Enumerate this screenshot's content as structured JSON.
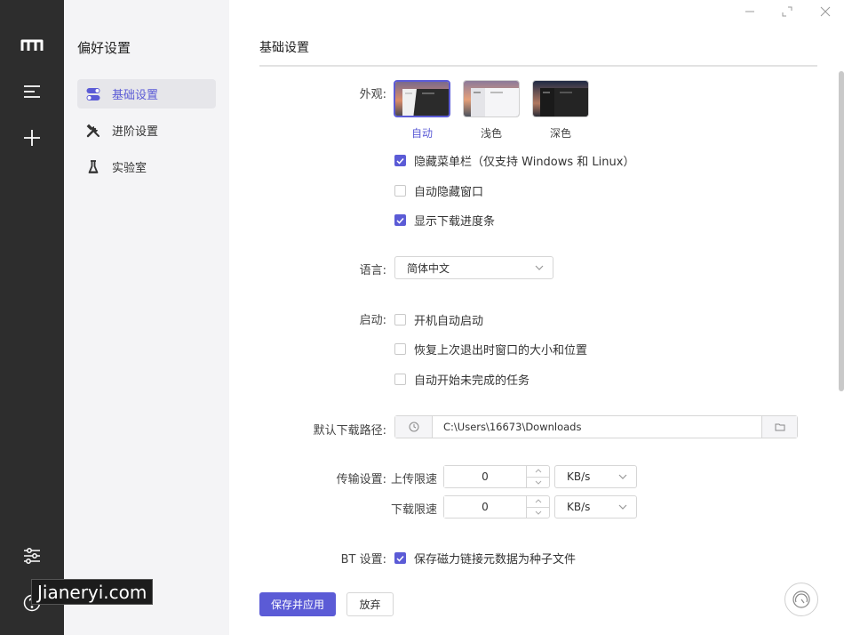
{
  "nav": {
    "title": "偏好设置",
    "items": [
      {
        "label": "基础设置",
        "icon": "toggle-icon"
      },
      {
        "label": "进阶设置",
        "icon": "tools-icon"
      },
      {
        "label": "实验室",
        "icon": "flask-icon"
      }
    ]
  },
  "main": {
    "title": "基础设置",
    "appearance": {
      "label": "外观:",
      "themes": [
        {
          "name": "自动",
          "selected": true
        },
        {
          "name": "浅色",
          "selected": false
        },
        {
          "name": "深色",
          "selected": false
        }
      ],
      "options": [
        {
          "label": "隐藏菜单栏（仅支持 Windows 和 Linux）",
          "checked": true
        },
        {
          "label": "自动隐藏窗口",
          "checked": false
        },
        {
          "label": "显示下载进度条",
          "checked": true
        }
      ]
    },
    "language": {
      "label": "语言:",
      "value": "简体中文"
    },
    "startup": {
      "label": "启动:",
      "options": [
        {
          "label": "开机自动启动",
          "checked": false
        },
        {
          "label": "恢复上次退出时窗口的大小和位置",
          "checked": false
        },
        {
          "label": "自动开始未完成的任务",
          "checked": false
        }
      ]
    },
    "download_path": {
      "label": "默认下载路径:",
      "value": "C:\\Users\\16673\\Downloads"
    },
    "transfer": {
      "label": "传输设置:",
      "upload": {
        "label": "上传限速",
        "value": "0",
        "unit": "KB/s"
      },
      "download": {
        "label": "下载限速",
        "value": "0",
        "unit": "KB/s"
      }
    },
    "bt": {
      "label": "BT 设置:",
      "option": {
        "label": "保存磁力链接元数据为种子文件",
        "checked": true
      }
    },
    "buttons": {
      "save": "保存并应用",
      "discard": "放弃"
    }
  },
  "watermark": "Jianeryi.com",
  "colors": {
    "accent": "#5b5bd6",
    "rail": "#2d2d2d",
    "nav_bg": "#f4f4f6"
  }
}
